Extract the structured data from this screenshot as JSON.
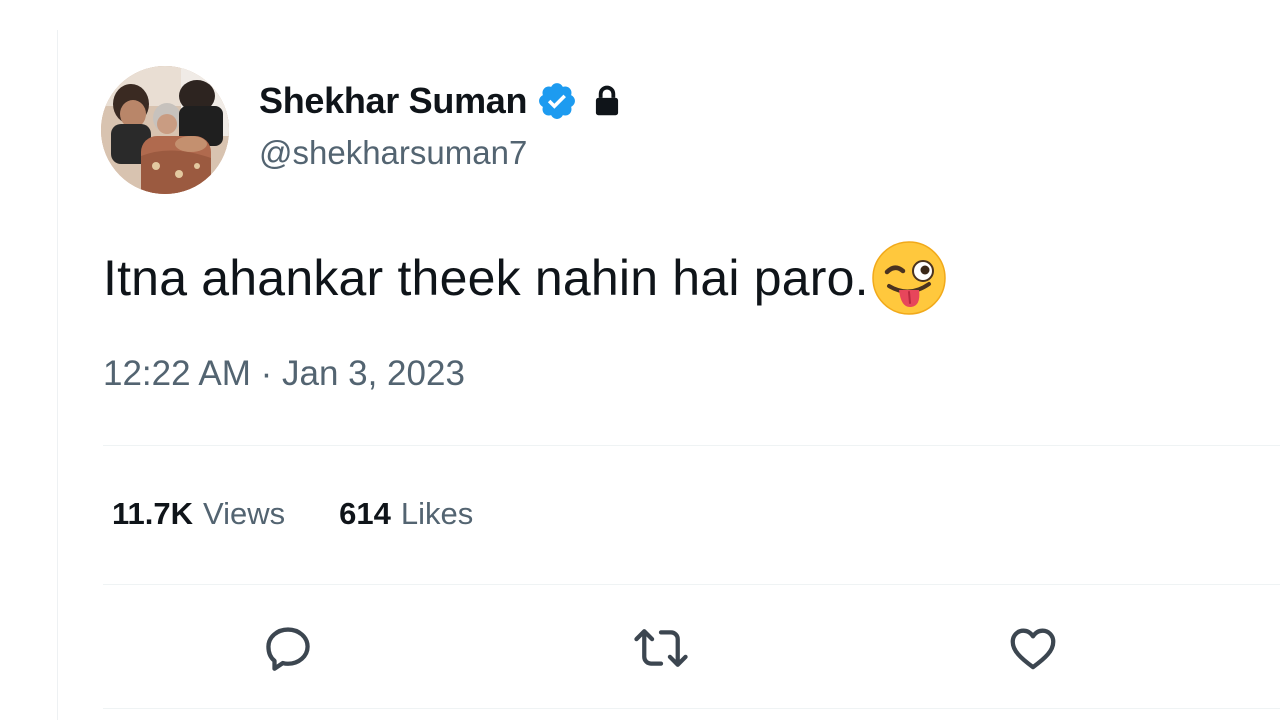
{
  "author": {
    "display_name": "Shekhar Suman",
    "handle": "@shekharsuman7",
    "avatar_icon": "profile-photo",
    "verified_icon": "verified-badge-icon",
    "protected_icon": "lock-icon",
    "verified_color": "#1d9bf0"
  },
  "tweet": {
    "text": "Itna ahankar theek nahin hai paro.",
    "emoji": "winking-face-with-tongue-emoji",
    "timestamp": "12:22 AM · Jan 3, 2023"
  },
  "stats": {
    "views_count": "11.7K",
    "views_label": "Views",
    "likes_count": "614",
    "likes_label": "Likes"
  },
  "actions": [
    {
      "name": "reply",
      "icon": "reply-icon"
    },
    {
      "name": "retweet",
      "icon": "retweet-icon"
    },
    {
      "name": "like",
      "icon": "heart-icon"
    }
  ],
  "colors": {
    "text_primary": "#0f1419",
    "text_secondary": "#536471",
    "divider": "#eff3f4"
  }
}
